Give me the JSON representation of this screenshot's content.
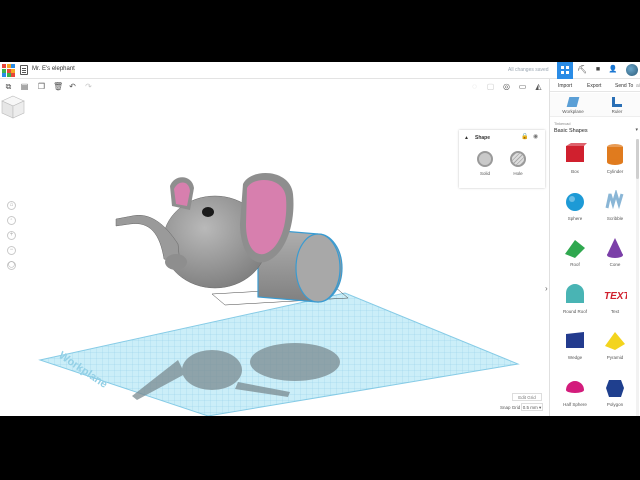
{
  "titlebar": {
    "document_title": "Mr. E's elephant",
    "save_status": "All changes saved",
    "logo_colors": [
      "#e8463a",
      "#f6a623",
      "#2a8ce6",
      "#3cb44b",
      "#e8463a",
      "#f6a623",
      "#2a8ce6",
      "#3cb44b",
      "#e8463a"
    ],
    "accent": "#2a8ce6"
  },
  "toolbar": {
    "icons": [
      "copy-icon",
      "paste-icon",
      "duplicate-icon",
      "delete-icon",
      "undo-icon",
      "redo-icon"
    ]
  },
  "shape_panel": {
    "title": "Shape",
    "solid_label": "Solid",
    "hole_label": "Hole"
  },
  "viewport": {
    "workplane_label": "Workplane",
    "edit_grid_label": "Edit Grid",
    "snap_grid_label": "Snap Grid",
    "snap_grid_value": "0.5 mm ▾",
    "grid_color": "#8fd3ec",
    "elephant_body_color": "#9b9b9b",
    "elephant_ear_color": "#d77fae"
  },
  "right_panel": {
    "tabs": {
      "import": "Import",
      "export": "Export",
      "send_to": "Send To"
    },
    "tools": {
      "workplane": "Workplane",
      "ruler": "Ruler"
    },
    "library_caption": "Tinkercad",
    "library_name": "Basic Shapes",
    "shapes": [
      {
        "label": "Box",
        "color": "#d0202e"
      },
      {
        "label": "Cylinder",
        "color": "#e07b1e"
      },
      {
        "label": "Sphere",
        "color": "#1d9ad6"
      },
      {
        "label": "Scribble",
        "color": "#8ab6d6"
      },
      {
        "label": "Roof",
        "color": "#2fa84f"
      },
      {
        "label": "Cone",
        "color": "#7b3fa8"
      },
      {
        "label": "Round Roof",
        "color": "#49b4b4"
      },
      {
        "label": "Text",
        "color": "#d0202e"
      },
      {
        "label": "Wedge",
        "color": "#233b8e"
      },
      {
        "label": "Pyramid",
        "color": "#f3d41d"
      },
      {
        "label": "Half Sphere",
        "color": "#d31c7c"
      },
      {
        "label": "Polygon",
        "color": "#1f3f8e"
      }
    ]
  }
}
